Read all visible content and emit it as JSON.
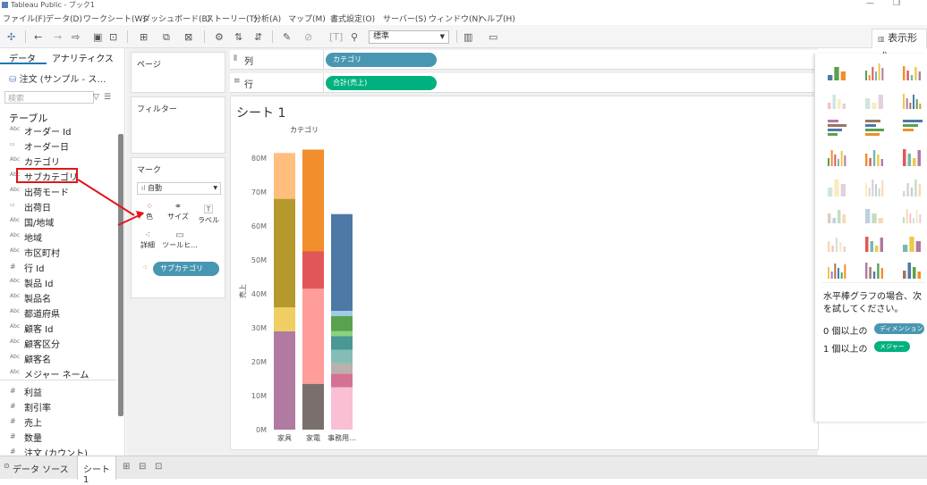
{
  "window": {
    "title": "Tableau Public - ブック1",
    "minimize": "—",
    "maximize": "❐"
  },
  "menu": [
    "ファイル(F)",
    "データ(D)",
    "ワークシート(W)",
    "ダッシュボード(B)",
    "ストーリー(T)",
    "分析(A)",
    "マップ(M)",
    "書式設定(O)",
    "サーバー(S)",
    "ウィンドウ(N)",
    "ヘルプ(H)"
  ],
  "toolbar": {
    "fit_value": "標準",
    "showme_label": "表示形式"
  },
  "datapane": {
    "tabs": [
      "データ",
      "アナリティクス"
    ],
    "datasource": "注文 (サンプル - ス…",
    "search_placeholder": "検索",
    "section": "テーブル",
    "dimensions": [
      {
        "icon": "Abc",
        "label": "オーダー Id"
      },
      {
        "icon": "▭",
        "label": "オーダー日"
      },
      {
        "icon": "Abc",
        "label": "カテゴリ"
      },
      {
        "icon": "Abc",
        "label": "サブカテゴリ"
      },
      {
        "icon": "Abc",
        "label": "出荷モード"
      },
      {
        "icon": "▭",
        "label": "出荷日"
      },
      {
        "icon": "Abc",
        "label": "国/地域"
      },
      {
        "icon": "Abc",
        "label": "地域"
      },
      {
        "icon": "Abc",
        "label": "市区町村"
      },
      {
        "icon": "#",
        "label": "行 Id"
      },
      {
        "icon": "Abc",
        "label": "製品 Id"
      },
      {
        "icon": "Abc",
        "label": "製品名"
      },
      {
        "icon": "Abc",
        "label": "都道府県"
      },
      {
        "icon": "Abc",
        "label": "顧客 Id"
      },
      {
        "icon": "Abc",
        "label": "顧客区分"
      },
      {
        "icon": "Abc",
        "label": "顧客名"
      },
      {
        "icon": "Abc",
        "label": "メジャー ネーム"
      }
    ],
    "measures": [
      {
        "icon": "#",
        "label": "利益"
      },
      {
        "icon": "#",
        "label": "割引率"
      },
      {
        "icon": "#",
        "label": "売上"
      },
      {
        "icon": "#",
        "label": "数量"
      },
      {
        "icon": "#",
        "label": "注文 (カウント)"
      }
    ]
  },
  "shelves": {
    "pages": "ページ",
    "filters": "フィルター",
    "marks": "マーク",
    "mark_type": "自動",
    "mark_buttons": {
      "color": "色",
      "size": "サイズ",
      "label": "ラベル",
      "detail": "詳細",
      "tooltip": "ツールヒ..."
    },
    "color_pill": "サブカテゴリ",
    "columns_label": "列",
    "rows_label": "行",
    "columns_pill": "カテゴリ",
    "rows_pill": "合計(売上)"
  },
  "sheet": {
    "title": "シート 1"
  },
  "chart_data": {
    "type": "bar",
    "stacked": true,
    "title": "",
    "header": "カテゴリ",
    "xlabel": "",
    "ylabel": "売上",
    "ylim": [
      0,
      85
    ],
    "yticks": [
      "0M",
      "10M",
      "20M",
      "30M",
      "40M",
      "50M",
      "60M",
      "70M",
      "80M"
    ],
    "categories": [
      "家具",
      "家電",
      "事務用..."
    ],
    "stacks": [
      [
        {
          "value": 29,
          "color": "#b07aa1"
        },
        {
          "value": 7,
          "color": "#f1ce63"
        },
        {
          "value": 32,
          "color": "#b6992d"
        },
        {
          "value": 13.5,
          "color": "#ffbe7d"
        }
      ],
      [
        {
          "value": 13.5,
          "color": "#79706e"
        },
        {
          "value": 28,
          "color": "#ff9d9a"
        },
        {
          "value": 11,
          "color": "#e15759"
        },
        {
          "value": 30,
          "color": "#f28e2b"
        }
      ],
      [
        {
          "value": 12.5,
          "color": "#fabfd2"
        },
        {
          "value": 4,
          "color": "#d37295"
        },
        {
          "value": 3,
          "color": "#bab0ac"
        },
        {
          "value": 4,
          "color": "#86bcb6"
        },
        {
          "value": 4,
          "color": "#499894"
        },
        {
          "value": 1.5,
          "color": "#8cd17d"
        },
        {
          "value": 4.5,
          "color": "#59a14f"
        },
        {
          "value": 1.5,
          "color": "#a0cbe8"
        },
        {
          "value": 28.5,
          "color": "#4e79a7"
        }
      ]
    ]
  },
  "showme": {
    "hint": "水平棒グラフの場合、次を試してください。",
    "req1_prefix": "0 個以上の",
    "req1_pill": "ディメンション",
    "req2_prefix": "1 個以上の",
    "req2_pill": "メジャー"
  },
  "bottom": {
    "datasource_tab": "データ ソース",
    "sheet_tab": "シート 1"
  },
  "colors": {
    "dimension_pill": "#4996b2",
    "measure_pill": "#00b180",
    "annotation": "#e0161b"
  }
}
